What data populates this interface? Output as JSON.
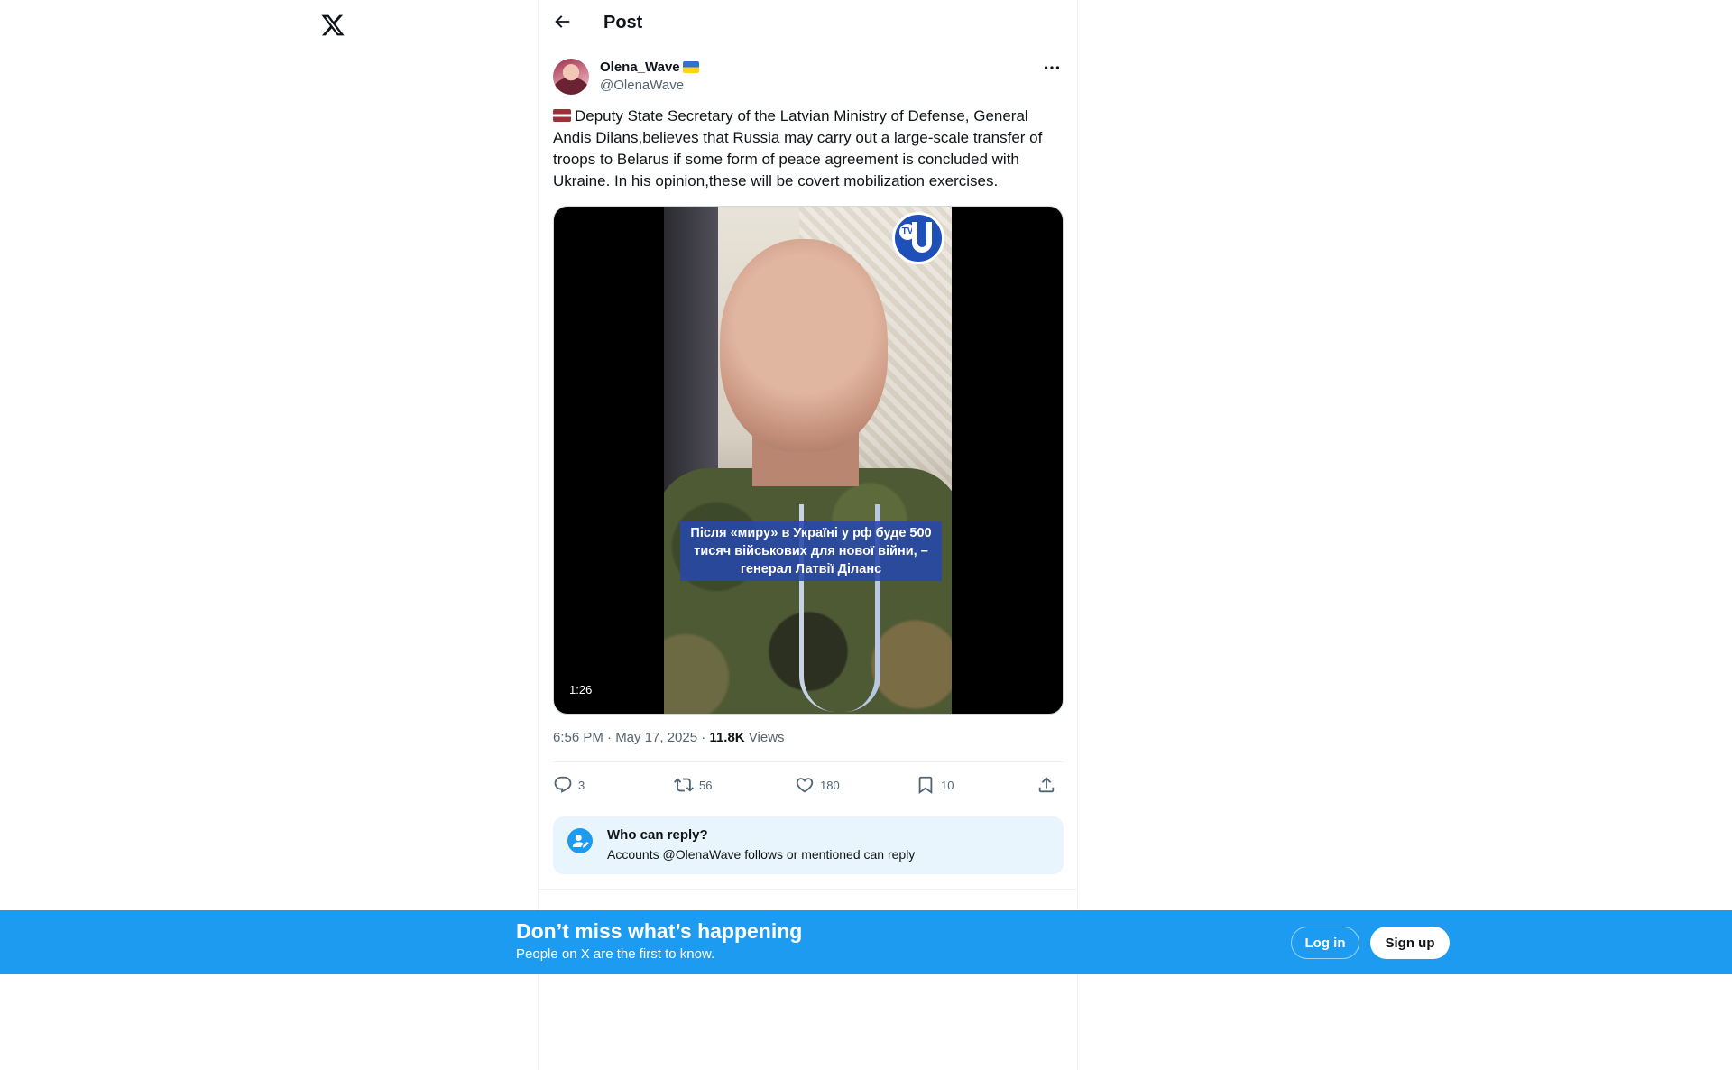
{
  "nav": {
    "logo_icon": "x-logo-icon"
  },
  "header": {
    "title": "Post",
    "back_icon": "arrow-left-icon"
  },
  "post": {
    "author": {
      "display_name": "Olena_Wave",
      "name_flag": "flag-ukraine-emoji",
      "handle": "@OlenaWave"
    },
    "text": "Deputy State Secretary of the Latvian Ministry of Defense, General Andis Dilans,believes that Russia may carry out a large-scale transfer of troops to Belarus if some form of peace agreement is concluded with Ukraine. In his opinion,these will be covert mobilization exercises.",
    "text_flag": "flag-latvia-emoji",
    "media": {
      "type": "video",
      "caption": "Після «миру» в Україні у рф буде 500 тисяч військових для нової війни, – генерал Латвії Діланс",
      "duration": "1:26",
      "channel_logo": "tv-u-logo"
    },
    "timestamp": "6:56 PM · May 17, 2025",
    "views_count": "11.8K",
    "views_label": "Views",
    "actions": {
      "replies": "3",
      "reposts": "56",
      "likes": "180",
      "bookmarks": "10"
    },
    "who_can_reply": {
      "title": "Who can reply?",
      "subtitle": "Accounts @OlenaWave follows or mentioned can reply"
    }
  },
  "banner": {
    "title": "Don’t miss what’s happening",
    "subtitle": "People on X are the first to know.",
    "login_label": "Log in",
    "signup_label": "Sign up"
  },
  "colors": {
    "accent": "#1d9bf0",
    "text_primary": "#0f1419",
    "text_secondary": "#536471",
    "reply_box_bg": "#e8f5fd"
  }
}
